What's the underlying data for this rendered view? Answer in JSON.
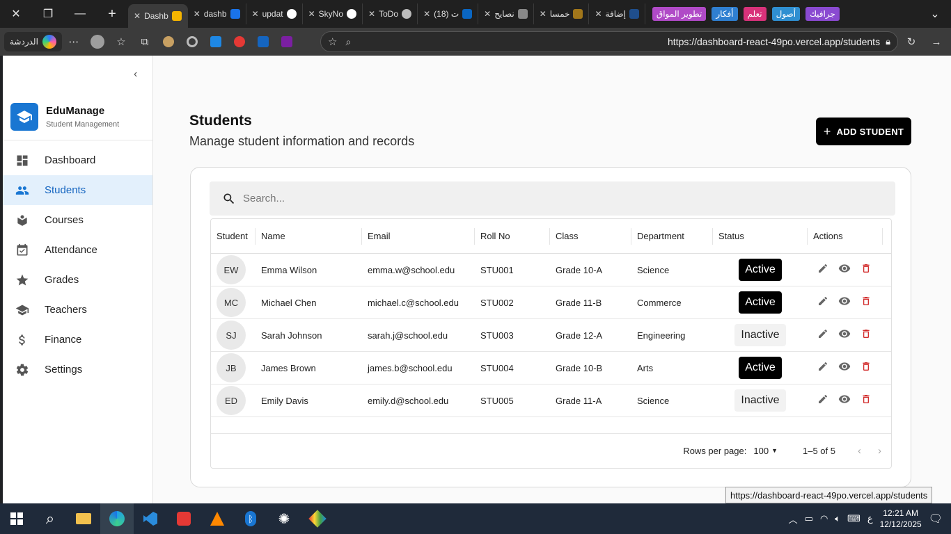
{
  "browser": {
    "tabs": [
      {
        "label": "Dashb",
        "active": true
      },
      {
        "label": "dashb"
      },
      {
        "label": "updat"
      },
      {
        "label": "SkyNo"
      },
      {
        "label": "ToDo"
      },
      {
        "label": "(18) ت"
      },
      {
        "label": "نصايح"
      },
      {
        "label": "خمسا"
      },
      {
        "label": "إضافة"
      }
    ],
    "bookmarks": [
      {
        "label": "تطوير المواق",
        "color": "#b04ac7"
      },
      {
        "label": "أفكار",
        "color": "#2f7fd1"
      },
      {
        "label": "تعلم",
        "color": "#d8327a"
      },
      {
        "label": "أصول",
        "color": "#2f8fd1"
      },
      {
        "label": "جرافيك",
        "color": "#8a4ad1"
      }
    ],
    "chat_label": "الدردشة",
    "url": "https://dashboard-react-49po.vercel.app/students"
  },
  "sidebar": {
    "brand_title": "EduManage",
    "brand_subtitle": "Student Management",
    "items": [
      {
        "label": "Dashboard",
        "icon": "dashboard-icon"
      },
      {
        "label": "Students",
        "icon": "people-icon",
        "active": true
      },
      {
        "label": "Courses",
        "icon": "book-icon"
      },
      {
        "label": "Attendance",
        "icon": "calendar-check-icon"
      },
      {
        "label": "Grades",
        "icon": "star-icon"
      },
      {
        "label": "Teachers",
        "icon": "school-icon"
      },
      {
        "label": "Finance",
        "icon": "dollar-icon"
      },
      {
        "label": "Settings",
        "icon": "gear-icon"
      }
    ]
  },
  "main": {
    "title": "Students",
    "subtitle": "Manage student information and records",
    "add_button": "ADD STUDENT",
    "search_placeholder": "Search..."
  },
  "table": {
    "columns": [
      "Student",
      "Name",
      "Email",
      "Roll No",
      "Class",
      "Department",
      "Status",
      "Actions"
    ],
    "rows": [
      {
        "initials": "EW",
        "name": "Emma Wilson",
        "email": "emma.w@school.edu",
        "roll": "STU001",
        "class": "Grade 10-A",
        "department": "Science",
        "status": "Active"
      },
      {
        "initials": "MC",
        "name": "Michael Chen",
        "email": "michael.c@school.edu",
        "roll": "STU002",
        "class": "Grade 11-B",
        "department": "Commerce",
        "status": "Active"
      },
      {
        "initials": "SJ",
        "name": "Sarah Johnson",
        "email": "sarah.j@school.edu",
        "roll": "STU003",
        "class": "Grade 12-A",
        "department": "Engineering",
        "status": "Inactive"
      },
      {
        "initials": "JB",
        "name": "James Brown",
        "email": "james.b@school.edu",
        "roll": "STU004",
        "class": "Grade 10-B",
        "department": "Arts",
        "status": "Active"
      },
      {
        "initials": "ED",
        "name": "Emily Davis",
        "email": "emily.d@school.edu",
        "roll": "STU005",
        "class": "Grade 11-A",
        "department": "Science",
        "status": "Inactive"
      }
    ],
    "rows_per_page_label": "Rows per page:",
    "rows_per_page": "100",
    "range": "1–5 of 5"
  },
  "tooltip": "https://dashboard-react-49po.vercel.app/students",
  "taskbar": {
    "time": "12:21 AM",
    "date": "12/12/2025",
    "lang": "ع"
  },
  "colors": {
    "accent": "#1976d2",
    "active_nav_bg": "#e3f0fc",
    "delete": "#d32f2f"
  }
}
